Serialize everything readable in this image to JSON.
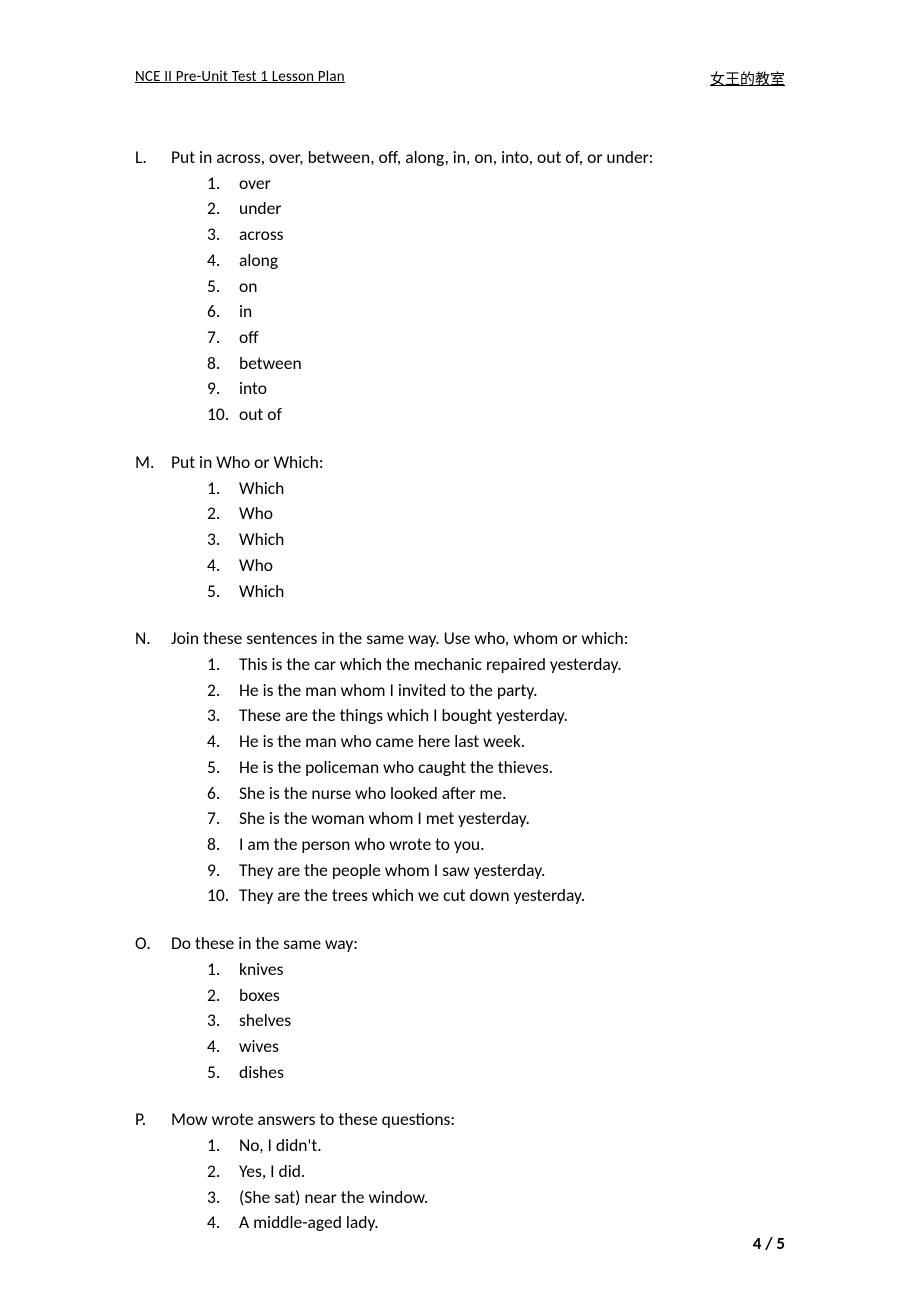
{
  "header": {
    "left": "NCE II Pre-Unit Test 1 Lesson Plan",
    "right": "女王的教室"
  },
  "sections": [
    {
      "letter": "L.",
      "prompt": "Put in across, over, between, off, along, in, on, into, out of, or under:",
      "items": [
        {
          "num": "1.",
          "text": "over"
        },
        {
          "num": "2.",
          "text": "under"
        },
        {
          "num": "3.",
          "text": "across"
        },
        {
          "num": "4.",
          "text": "along"
        },
        {
          "num": "5.",
          "text": "on"
        },
        {
          "num": "6.",
          "text": "in"
        },
        {
          "num": "7.",
          "text": "off"
        },
        {
          "num": "8.",
          "text": "between"
        },
        {
          "num": "9.",
          "text": "into"
        },
        {
          "num": "10.",
          "text": "out of"
        }
      ]
    },
    {
      "letter": "M.",
      "prompt": "Put in Who or Which:",
      "items": [
        {
          "num": "1.",
          "text": "Which"
        },
        {
          "num": "2.",
          "text": "Who"
        },
        {
          "num": "3.",
          "text": "Which"
        },
        {
          "num": "4.",
          "text": "Who"
        },
        {
          "num": "5.",
          "text": "Which"
        }
      ]
    },
    {
      "letter": "N.",
      "prompt": "Join these sentences in the same way. Use who, whom or which:",
      "items": [
        {
          "num": "1.",
          "text": "This is the car which the mechanic repaired yesterday."
        },
        {
          "num": "2.",
          "text": "He is the man whom I invited to the party."
        },
        {
          "num": "3.",
          "text": "These are the things which I bought yesterday."
        },
        {
          "num": "4.",
          "text": "He is the man who came here last week."
        },
        {
          "num": "5.",
          "text": "He is the policeman who caught the thieves."
        },
        {
          "num": "6.",
          "text": "She is the nurse who looked after me."
        },
        {
          "num": "7.",
          "text": "She is the woman whom I met yesterday."
        },
        {
          "num": "8.",
          "text": "I am the person who wrote to you."
        },
        {
          "num": "9.",
          "text": "They are the people whom I saw yesterday."
        },
        {
          "num": "10.",
          "text": "They are the trees which we cut down yesterday."
        }
      ]
    },
    {
      "letter": "O.",
      "prompt": "Do these in the same way:",
      "items": [
        {
          "num": "1.",
          "text": "knives"
        },
        {
          "num": "2.",
          "text": "boxes"
        },
        {
          "num": "3.",
          "text": "shelves"
        },
        {
          "num": "4.",
          "text": "wives"
        },
        {
          "num": "5.",
          "text": "dishes"
        }
      ]
    },
    {
      "letter": "P.",
      "prompt": "Mow wrote answers to these questions:",
      "items": [
        {
          "num": "1.",
          "text": "No, I didn't."
        },
        {
          "num": "2.",
          "text": "Yes, I did."
        },
        {
          "num": "3.",
          "text": "(She sat) near the window."
        },
        {
          "num": "4.",
          "text": "A middle-aged lady."
        }
      ]
    }
  ],
  "footer": {
    "page": "4 / 5"
  }
}
